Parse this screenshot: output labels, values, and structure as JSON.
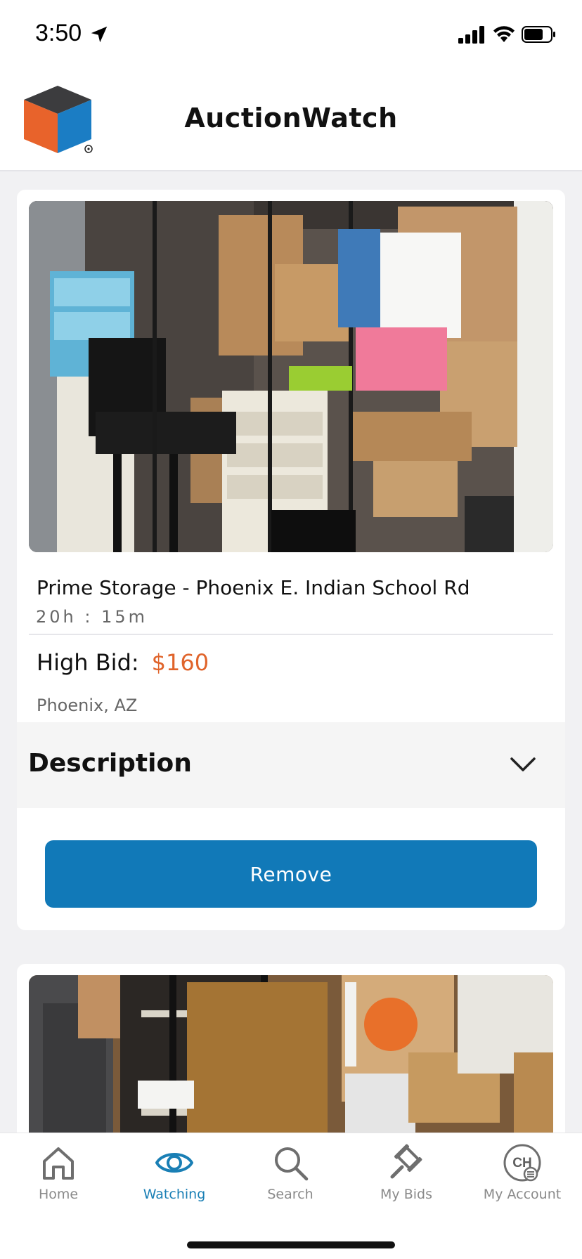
{
  "status_bar": {
    "time": "3:50"
  },
  "app": {
    "title": "AuctionWatch"
  },
  "listings": [
    {
      "title": "Prime Storage - Phoenix E. Indian School Rd",
      "time_left": "20h : 15m",
      "high_bid_label": "High Bid:",
      "high_bid_value": "$160",
      "location": "Phoenix, AZ",
      "description_label": "Description",
      "remove_label": "Remove"
    }
  ],
  "nav": {
    "items": [
      {
        "label": "Home",
        "icon": "home-icon",
        "active": false
      },
      {
        "label": "Watching",
        "icon": "eye-icon",
        "active": true
      },
      {
        "label": "Search",
        "icon": "search-icon",
        "active": false
      },
      {
        "label": "My Bids",
        "icon": "gavel-icon",
        "active": false
      },
      {
        "label": "My Account",
        "icon": "account-icon",
        "active": false
      },
      {
        "avatar_initials": "CH"
      }
    ]
  },
  "colors": {
    "accent": "#1179b8",
    "bid": "#e0642b",
    "nav_active": "#1a7fb5",
    "nav_inactive": "#8a8a8a"
  }
}
